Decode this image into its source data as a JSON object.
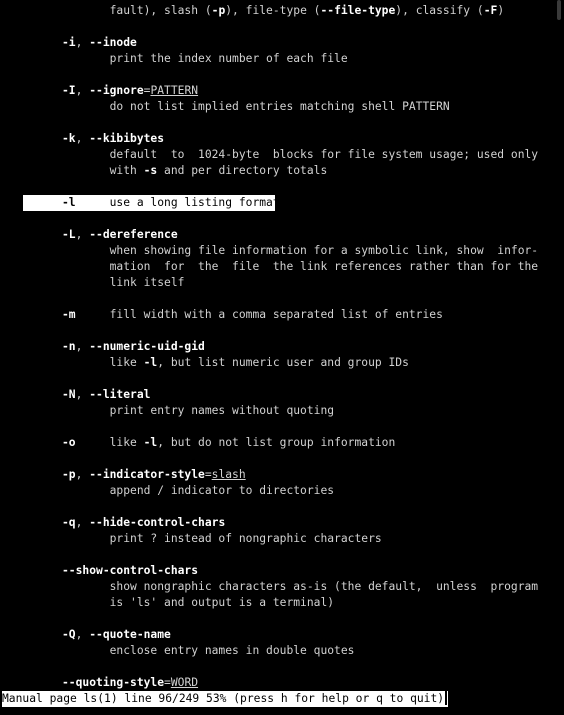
{
  "window": {
    "title": ""
  },
  "man": {
    "lines": [
      [
        [
          "",
          "            fault), slash ("
        ],
        [
          "b",
          "-p"
        ],
        [
          "",
          "), file-type ("
        ],
        [
          "b",
          "--file-type"
        ],
        [
          "",
          "), classify ("
        ],
        [
          "b",
          "-F"
        ],
        [
          "",
          ")"
        ]
      ],
      [],
      [
        [
          "b",
          "     -i"
        ],
        [
          "",
          ", "
        ],
        [
          "b",
          "--inode"
        ]
      ],
      [
        [
          "",
          "            print the index number of each file"
        ]
      ],
      [],
      [
        [
          "b",
          "     -I"
        ],
        [
          "",
          ", "
        ],
        [
          "b",
          "--ignore"
        ],
        [
          "",
          "="
        ],
        [
          "u",
          "PATTERN"
        ]
      ],
      [
        [
          "",
          "            do not list implied entries matching shell PATTERN"
        ]
      ],
      [],
      [
        [
          "b",
          "     -k"
        ],
        [
          "",
          ", "
        ],
        [
          "b",
          "--kibibytes"
        ]
      ],
      [
        [
          "",
          "            default  to  1024-byte  blocks for file system usage; used only"
        ]
      ],
      [
        [
          "",
          "            with "
        ],
        [
          "b",
          "-s"
        ],
        [
          "",
          " and per directory totals"
        ]
      ],
      [],
      [
        [
          "b",
          "     -l"
        ],
        [
          "",
          "     use a long listing format"
        ]
      ],
      [],
      [
        [
          "b",
          "     -L"
        ],
        [
          "",
          ", "
        ],
        [
          "b",
          "--dereference"
        ]
      ],
      [
        [
          "",
          "            when showing file information for a symbolic link, show  infor-"
        ]
      ],
      [
        [
          "",
          "            mation  for  the  file  the link references rather than for the"
        ]
      ],
      [
        [
          "",
          "            link itself"
        ]
      ],
      [],
      [
        [
          "b",
          "     -m"
        ],
        [
          "",
          "     fill width with a comma separated list of entries"
        ]
      ],
      [],
      [
        [
          "b",
          "     -n"
        ],
        [
          "",
          ", "
        ],
        [
          "b",
          "--numeric-uid-gid"
        ]
      ],
      [
        [
          "",
          "            like "
        ],
        [
          "b",
          "-l"
        ],
        [
          "",
          ", but list numeric user and group IDs"
        ]
      ],
      [],
      [
        [
          "b",
          "     -N"
        ],
        [
          "",
          ", "
        ],
        [
          "b",
          "--literal"
        ]
      ],
      [
        [
          "",
          "            print entry names without quoting"
        ]
      ],
      [],
      [
        [
          "b",
          "     -o"
        ],
        [
          "",
          "     like "
        ],
        [
          "b",
          "-l"
        ],
        [
          "",
          ", but do not list group information"
        ]
      ],
      [],
      [
        [
          "b",
          "     -p"
        ],
        [
          "",
          ", "
        ],
        [
          "b",
          "--indicator-style"
        ],
        [
          "",
          "="
        ],
        [
          "u",
          "slash"
        ]
      ],
      [
        [
          "",
          "            append / indicator to directories"
        ]
      ],
      [],
      [
        [
          "b",
          "     -q"
        ],
        [
          "",
          ", "
        ],
        [
          "b",
          "--hide-control-chars"
        ]
      ],
      [
        [
          "",
          "            print ? instead of nongraphic characters"
        ]
      ],
      [],
      [
        [
          "b",
          "     --show-control-chars"
        ]
      ],
      [
        [
          "",
          "            show nongraphic characters as-is (the default,  unless  program"
        ]
      ],
      [
        [
          "",
          "            is 'ls' and output is a terminal)"
        ]
      ],
      [],
      [
        [
          "b",
          "     -Q"
        ],
        [
          "",
          ", "
        ],
        [
          "b",
          "--quote-name"
        ]
      ],
      [
        [
          "",
          "            enclose entry names in double quotes"
        ]
      ],
      [],
      [
        [
          "b",
          "     --quoting-style"
        ],
        [
          "",
          "="
        ],
        [
          "u",
          "WORD"
        ]
      ]
    ],
    "highlighted_line": 12,
    "status": "Manual page ls(1) line 96/249 53% (press h for help or q to quit)"
  }
}
